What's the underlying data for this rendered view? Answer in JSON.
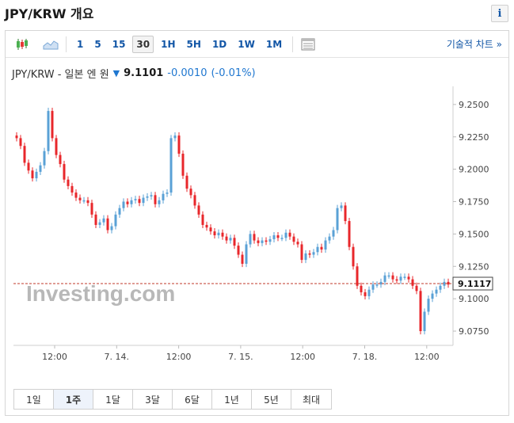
{
  "page": {
    "title": "JPY/KRW 개요",
    "info_label": "i"
  },
  "toolbar": {
    "timeframes": [
      "1",
      "5",
      "15",
      "30",
      "1H",
      "5H",
      "1D",
      "1W",
      "1M"
    ],
    "active_timeframe": "30",
    "tech_chart_label": "기술적 차트 »"
  },
  "quote": {
    "name": "JPY/KRW - 일본 엔 원",
    "price": "9.1101",
    "change": "-0.0010",
    "change_pct": "(-0.01%)"
  },
  "colors": {
    "up": "#5aa1d6",
    "down": "#e8272b",
    "link": "#1256a6",
    "current_line": "#c0392b"
  },
  "chart_data": {
    "type": "candlestick",
    "watermark": "Investing.com",
    "y_ticks": [
      "9.2500",
      "9.2250",
      "9.2000",
      "9.1750",
      "9.1500",
      "9.1250",
      "9.1000",
      "9.0750"
    ],
    "ylim": [
      9.064,
      9.264
    ],
    "x_ticks": [
      "12:00",
      "7. 14.",
      "12:00",
      "7. 15.",
      "12:00",
      "7. 18.",
      "12:00"
    ],
    "current_value": "9.1117",
    "close_series": [
      9.224,
      9.218,
      9.205,
      9.199,
      9.193,
      9.198,
      9.203,
      9.214,
      9.245,
      9.224,
      9.211,
      9.204,
      9.192,
      9.187,
      9.182,
      9.178,
      9.176,
      9.176,
      9.174,
      9.165,
      9.157,
      9.159,
      9.162,
      9.153,
      9.156,
      9.165,
      9.17,
      9.175,
      9.173,
      9.176,
      9.177,
      9.174,
      9.178,
      9.179,
      9.18,
      9.173,
      9.176,
      9.181,
      9.182,
      9.224,
      9.226,
      9.212,
      9.195,
      9.185,
      9.18,
      9.172,
      9.165,
      9.157,
      9.155,
      9.152,
      9.149,
      9.151,
      9.148,
      9.145,
      9.147,
      9.141,
      9.134,
      9.127,
      9.142,
      9.15,
      9.145,
      9.143,
      9.145,
      9.144,
      9.146,
      9.149,
      9.147,
      9.147,
      9.151,
      9.148,
      9.144,
      9.142,
      9.13,
      9.135,
      9.134,
      9.136,
      9.14,
      9.138,
      9.145,
      9.148,
      9.153,
      9.17,
      9.172,
      9.16,
      9.14,
      9.125,
      9.11,
      9.105,
      9.102,
      9.107,
      9.111,
      9.111,
      9.113,
      9.118,
      9.118,
      9.115,
      9.114,
      9.117,
      9.117,
      9.115,
      9.11,
      9.106,
      9.075,
      9.09,
      9.1,
      9.104,
      9.107,
      9.11,
      9.113,
      9.111
    ]
  },
  "ranges": {
    "items": [
      "1일",
      "1주",
      "1달",
      "3달",
      "6달",
      "1년",
      "5년",
      "최대"
    ],
    "active": "1주"
  }
}
